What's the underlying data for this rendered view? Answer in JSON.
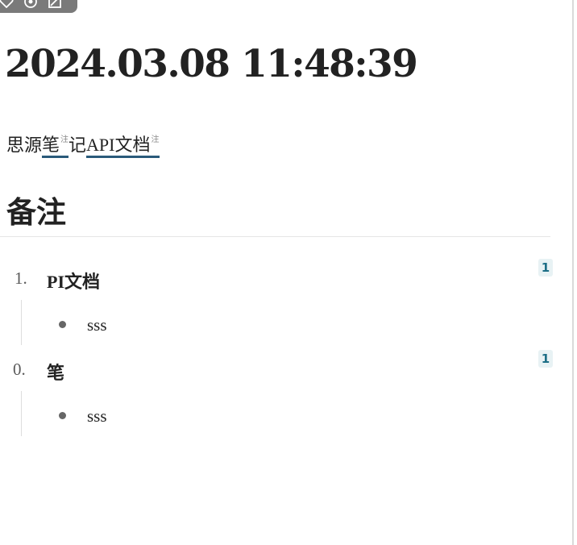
{
  "toolbar": {
    "icons": [
      "heart-icon",
      "eye-icon",
      "edit-icon"
    ]
  },
  "doc": {
    "title": "2024.03.08 11:48:39",
    "paragraph": {
      "seg1": "思源",
      "mark1": "笔",
      "sup1": "注",
      "seg2": "记",
      "mark2": "API文档",
      "sup2": "注"
    },
    "notes_heading": "备注"
  },
  "notes": [
    {
      "number": "1.",
      "title": "PI文档",
      "badge": "1",
      "children": [
        "sss"
      ]
    },
    {
      "number": "0.",
      "title": "笔",
      "badge": "1",
      "children": [
        "sss"
      ]
    }
  ],
  "colors": {
    "mark_underline": "#2a5a7a",
    "badge_text": "#1c6e86",
    "badge_bg": "#e8f2f4",
    "toolbar_bg": "#7a7a7a"
  }
}
